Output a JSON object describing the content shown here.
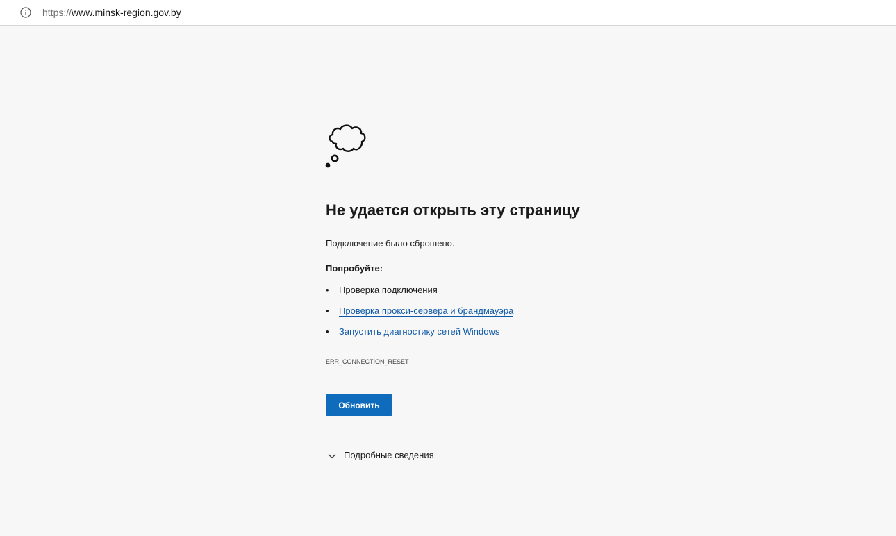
{
  "browser": {
    "url_scheme": "https://",
    "url_host": "www.minsk-region.gov.by",
    "info_icon": "info-icon"
  },
  "error_page": {
    "icon": "thought-cloud-icon",
    "title": "Не удается открыть эту страницу",
    "message": "Подключение было сброшено.",
    "try_heading": "Попробуйте:",
    "suggestions": [
      {
        "label": "Проверка подключения",
        "is_link": false
      },
      {
        "label": "Проверка прокси-сервера и брандмауэра",
        "is_link": true
      },
      {
        "label": "Запустить диагностику сетей Windows",
        "is_link": true
      }
    ],
    "error_code": "ERR_CONNECTION_RESET",
    "refresh_button": "Обновить",
    "details_label": "Подробные сведения",
    "details_icon": "chevron-down-icon"
  },
  "colors": {
    "page_background": "#f7f7f7",
    "accent_button": "#0f6cbd",
    "link": "#0f5aa8",
    "text": "#1b1b1b"
  }
}
